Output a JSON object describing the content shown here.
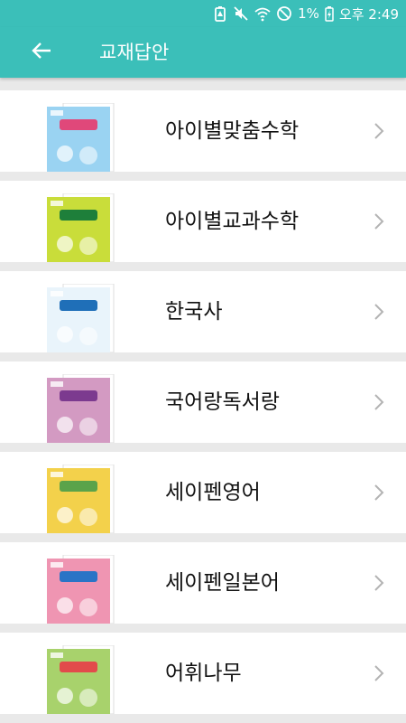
{
  "status_bar": {
    "battery_percent": "1%",
    "time": "오후 2:49"
  },
  "header": {
    "title": "교재답안"
  },
  "items": [
    {
      "label": "아이별맞춤수학",
      "cover_color": "#9ad3f2",
      "accent": "#e0487a"
    },
    {
      "label": "아이별교과수학",
      "cover_color": "#c9dd3a",
      "accent": "#1e7f3a"
    },
    {
      "label": "한국사",
      "cover_color": "#e9f4fb",
      "accent": "#1f6fb8"
    },
    {
      "label": "국어랑독서랑",
      "cover_color": "#d39ac2",
      "accent": "#7c3a8f"
    },
    {
      "label": "세이펜영어",
      "cover_color": "#f3d14b",
      "accent": "#5aa34a"
    },
    {
      "label": "세이펜일본어",
      "cover_color": "#ef95b2",
      "accent": "#2a74c6"
    },
    {
      "label": "어휘나무",
      "cover_color": "#a8d26c",
      "accent": "#e24b4b"
    }
  ]
}
